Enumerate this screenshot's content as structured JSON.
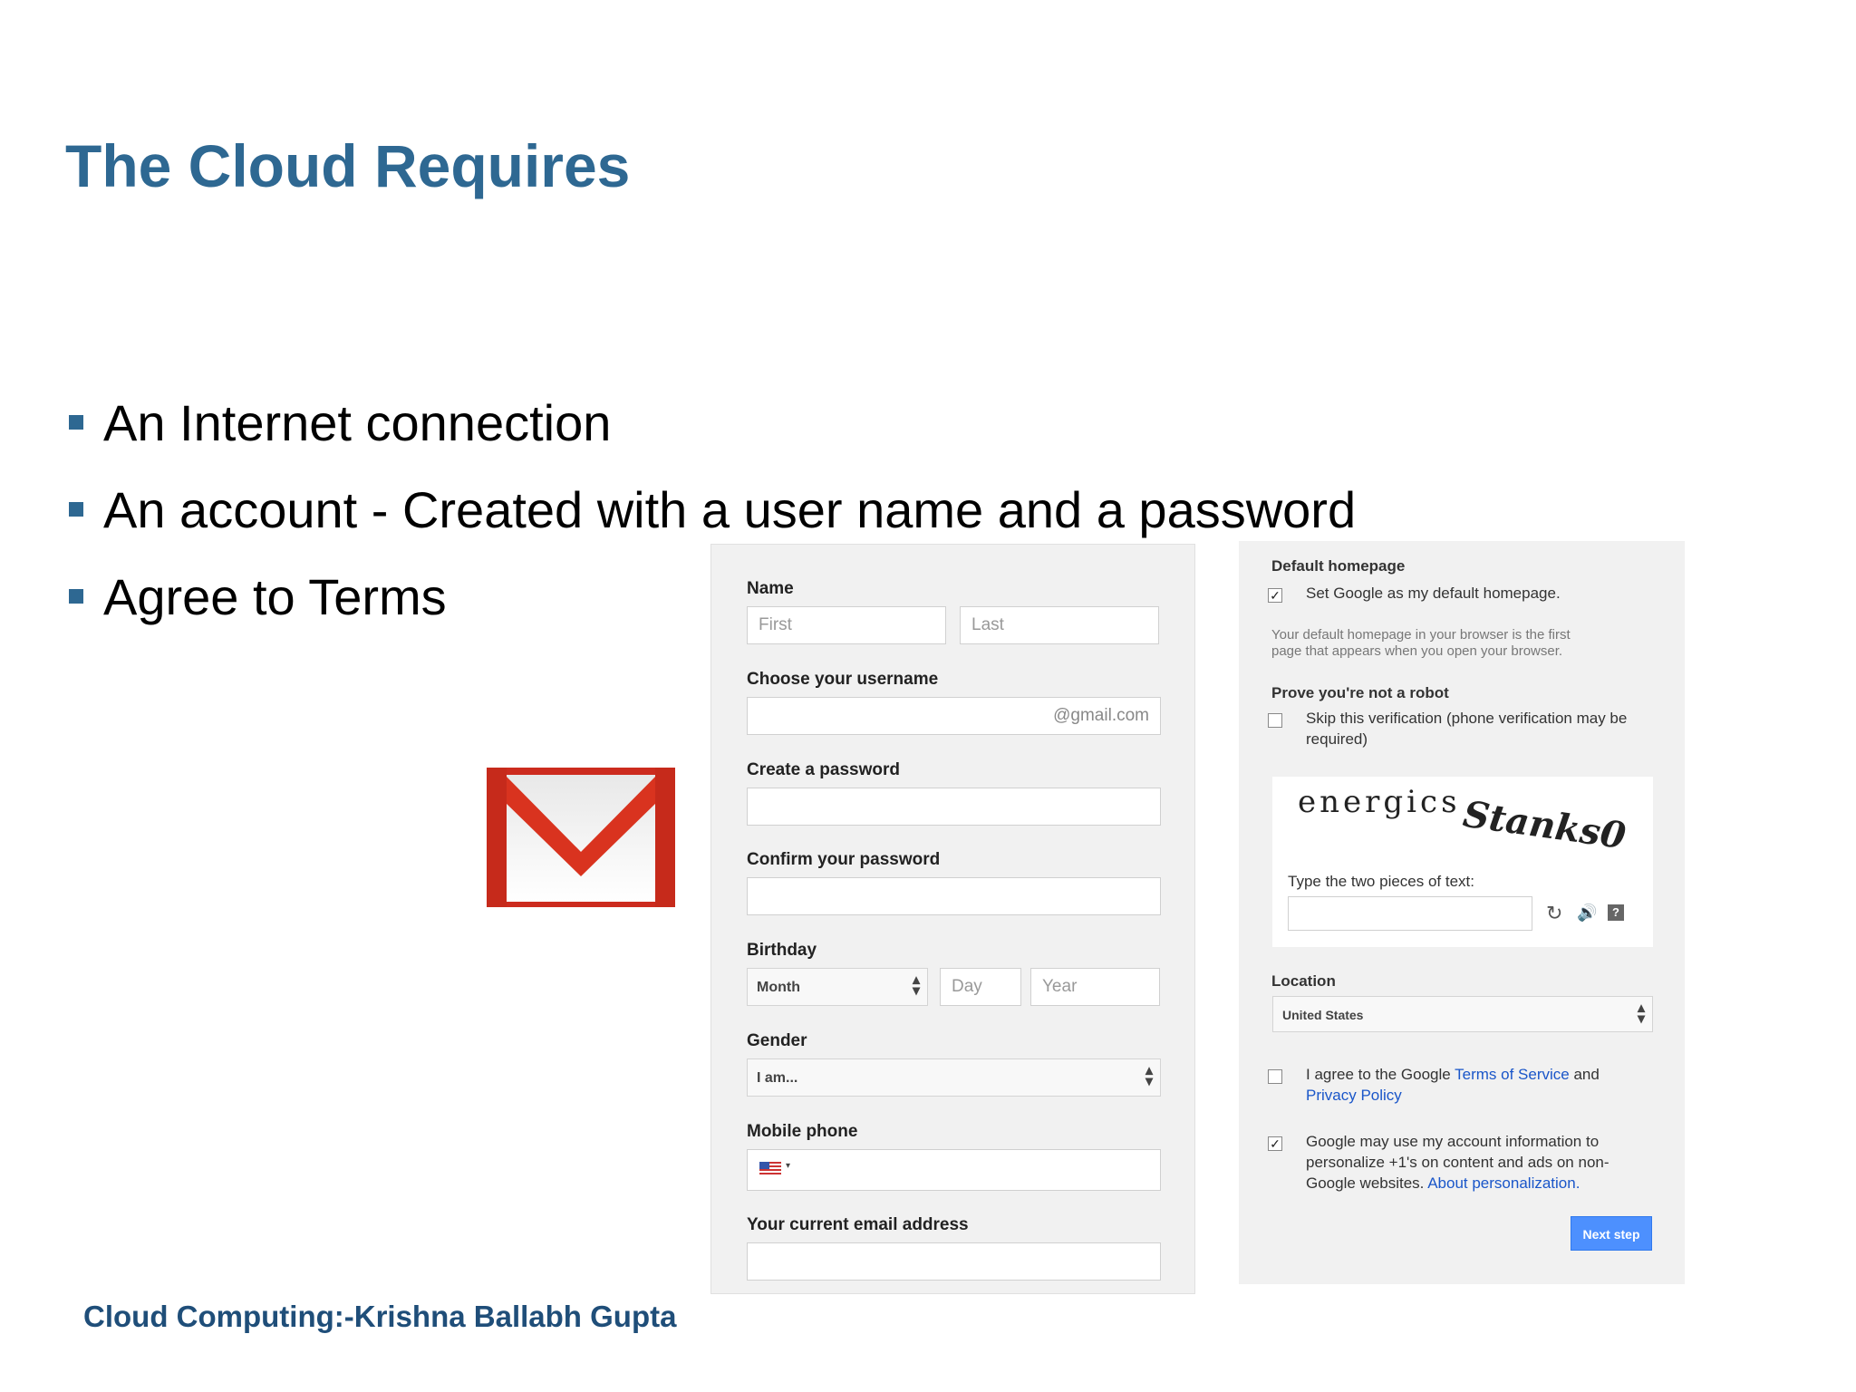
{
  "slide": {
    "title": "The Cloud Requires",
    "bullets": [
      "An Internet connection",
      "An account - Created with a user name and a password",
      "Agree to Terms"
    ],
    "footer": "Cloud Computing:-Krishna Ballabh Gupta"
  },
  "colors": {
    "title": "#2e6892",
    "footer": "#1f4e79",
    "link": "#1a56c9",
    "button": "#4d90fe"
  },
  "signup_form": {
    "name_label": "Name",
    "first_placeholder": "First",
    "last_placeholder": "Last",
    "username_label": "Choose your username",
    "username_suffix": "@gmail.com",
    "password_label": "Create a password",
    "confirm_label": "Confirm your password",
    "birthday_label": "Birthday",
    "month_value": "Month",
    "day_placeholder": "Day",
    "year_placeholder": "Year",
    "gender_label": "Gender",
    "gender_value": "I am...",
    "mobile_label": "Mobile phone",
    "email_label": "Your current email address"
  },
  "right_panel": {
    "homepage_heading": "Default homepage",
    "homepage_checkbox": "Set Google as my default homepage.",
    "homepage_note_1": "Your default homepage in your browser is the first",
    "homepage_note_2": "page that appears when you open your browser.",
    "robot_heading": "Prove you're not a robot",
    "skip_line_1": "Skip this verification (phone verification may be",
    "skip_line_2": "required)",
    "captcha_word_1": "energics",
    "captcha_word_2": "Stanks0",
    "captcha_prompt": "Type the two pieces of text:",
    "location_label": "Location",
    "location_value": "United States",
    "agree_prefix": "I agree to the Google ",
    "agree_tos": "Terms of Service",
    "agree_and": " and",
    "agree_privacy": "Privacy Policy",
    "personalize_line_1": "Google may use my account information to",
    "personalize_line_2": "personalize +1's on content and ads on non-",
    "personalize_line_3a": "Google websites. ",
    "personalize_link": "About personalization.",
    "next_button": "Next step"
  }
}
